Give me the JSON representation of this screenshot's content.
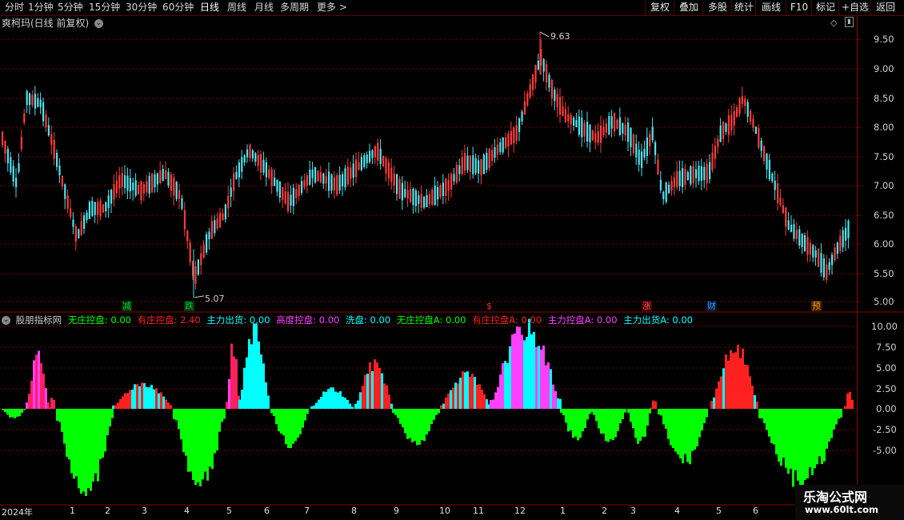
{
  "toolbar": {
    "periods": [
      "分时",
      "1分钟",
      "5分钟",
      "15分钟",
      "30分钟",
      "60分钟",
      "日线",
      "周线",
      "月线",
      "多周期",
      "更多 >"
    ],
    "active_period": "日线",
    "buttons": [
      "复权",
      "叠加",
      "多股",
      "统计",
      "画线",
      "F10",
      "标记",
      "+自选",
      "返回"
    ]
  },
  "price_panel": {
    "title": "爽柯玛(日线 前复权)",
    "y_ticks": [
      "9.50",
      "9.00",
      "8.50",
      "8.00",
      "7.50",
      "7.00",
      "6.50",
      "6.00",
      "5.50",
      "5.00"
    ],
    "high_label": "9.63",
    "low_label": "5.07",
    "events": [
      {
        "text": "减",
        "color": "#00cc44",
        "bg": "#003300"
      },
      {
        "text": "跌",
        "color": "#00cc44",
        "bg": "#003300"
      },
      {
        "text": "$",
        "color": "#ff3030",
        "bg": ""
      },
      {
        "text": "涨",
        "color": "#ff5050",
        "bg": "#400000"
      },
      {
        "text": "财",
        "color": "#3399ff",
        "bg": "#001a33"
      },
      {
        "text": "预",
        "color": "#ff9900",
        "bg": "#402000"
      }
    ]
  },
  "indicator_panel": {
    "name": "股朋指标网",
    "legend": [
      {
        "label": "无庄控盘: 0.00",
        "color": "#00ff00"
      },
      {
        "label": "有庄控盘: 2.40",
        "color": "#ff2020"
      },
      {
        "label": "主力出货: 0.00",
        "color": "#00ffff"
      },
      {
        "label": "高度控盘: 0.00",
        "color": "#ff40ff"
      },
      {
        "label": "洗盘: 0.00",
        "color": "#00ffff"
      },
      {
        "label": "无庄控盘A: 0.00",
        "color": "#00ff00"
      },
      {
        "label": "有庄控盘A: 0.00",
        "color": "#ff2020"
      },
      {
        "label": "主力控盘A: 0.00",
        "color": "#ff40ff"
      },
      {
        "label": "主力出货A: 0.00",
        "color": "#00ffff"
      }
    ],
    "y_ticks": [
      "10.00",
      "7.50",
      "5.00",
      "2.50",
      "0.00",
      "-2.50",
      "-5.00"
    ]
  },
  "x_axis": {
    "labels": [
      "2024年",
      "1",
      "2",
      "3",
      "4",
      "5",
      "6",
      "7",
      "8",
      "9",
      "10",
      "11",
      "12",
      "1",
      "2",
      "3",
      "4",
      "5",
      "6"
    ]
  },
  "watermark": {
    "line1": "乐淘公式网",
    "line2": "www.60lt.com"
  },
  "colors": {
    "up": "#ff3c3c",
    "down": "#4fe4f0",
    "bg": "#000000",
    "grid": "#7a0000",
    "axis": "#8b0000"
  }
}
